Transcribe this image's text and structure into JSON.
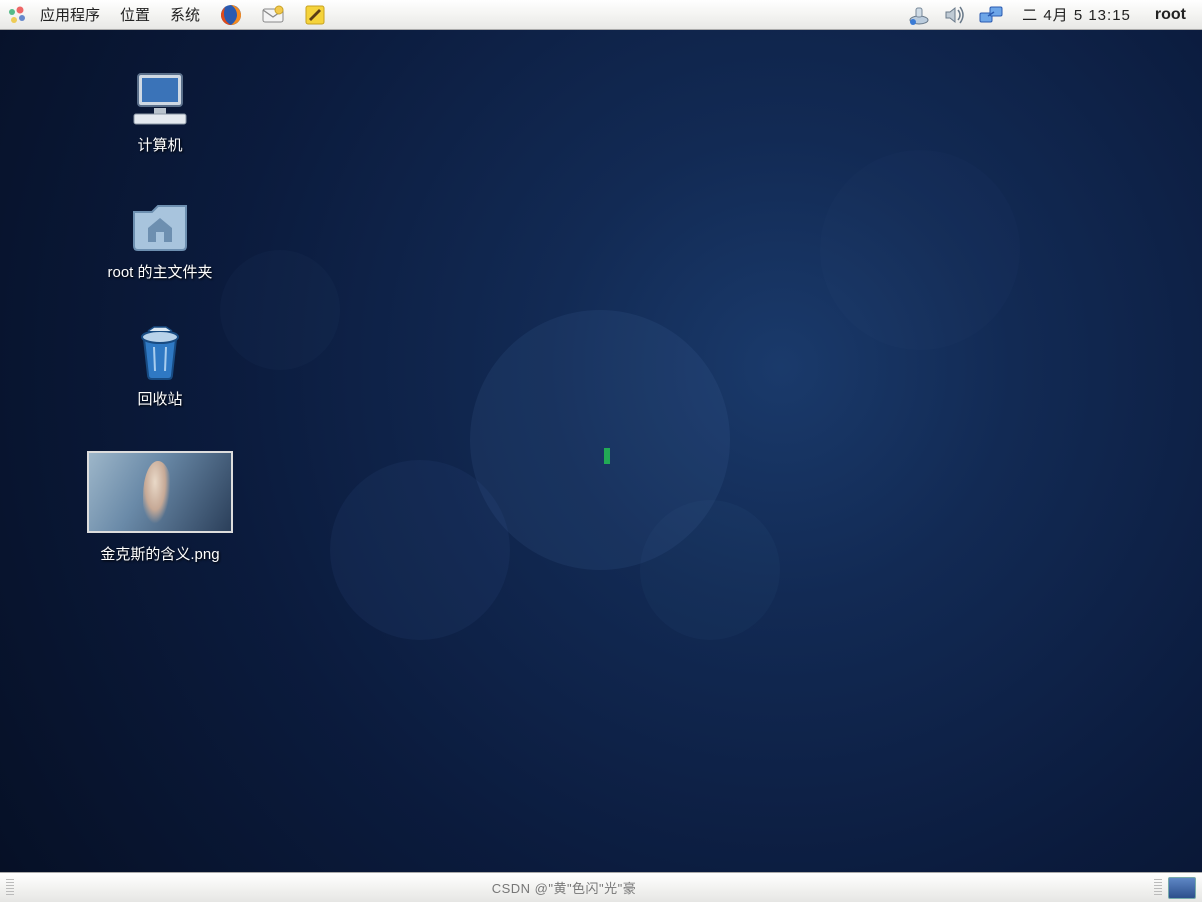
{
  "panel": {
    "menus": {
      "applications": "应用程序",
      "places": "位置",
      "system": "系统"
    },
    "clock": "二 4月  5 13:15",
    "user": "root"
  },
  "desktop_icons": {
    "computer": "计算机",
    "home": "root 的主文件夹",
    "trash": "回收站",
    "image_file": "金克斯的含义.png"
  },
  "watermark": "CSDN @\"黄\"色闪\"光\"豪"
}
